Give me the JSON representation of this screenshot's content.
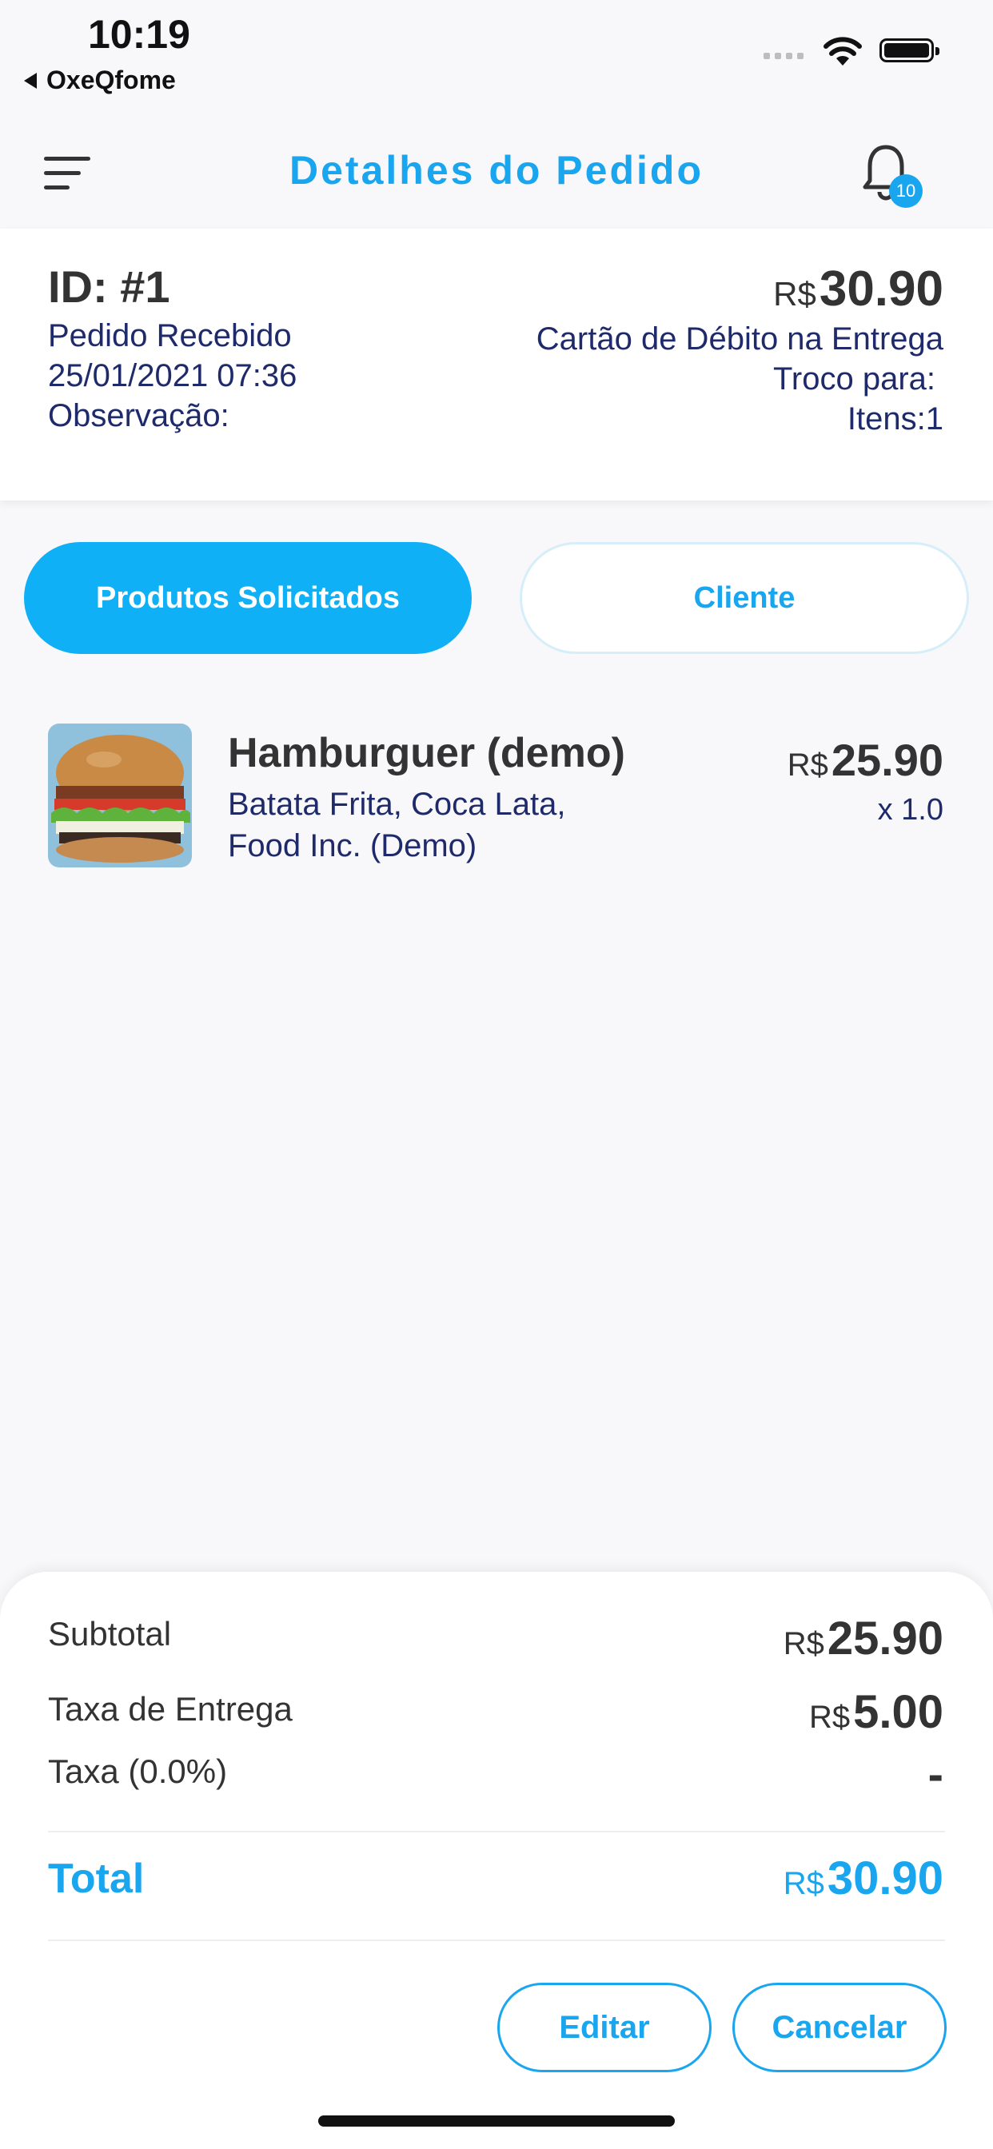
{
  "status_bar": {
    "time": "10:19",
    "back_app": "OxeQfome"
  },
  "header": {
    "title": "Detalhes do Pedido",
    "notification_count": "10"
  },
  "order": {
    "id": "ID: #1",
    "status": "Pedido Recebido",
    "datetime": "25/01/2021 07:36",
    "observation_label": "Observação:",
    "currency": "R$",
    "total_amount": "30.90",
    "payment_method": "Cartão de Débito na Entrega",
    "change_label": "Troco para:",
    "items_label": "Itens:1"
  },
  "tabs": [
    {
      "label": "Produtos Solicitados",
      "active": true
    },
    {
      "label": "Cliente",
      "active": false
    }
  ],
  "products": [
    {
      "name": "Hamburguer (demo)",
      "description_line1": "Batata Frita, Coca Lata,",
      "description_line2": "Food Inc. (Demo)",
      "currency": "R$",
      "price": "25.90",
      "quantity": "x 1.0"
    }
  ],
  "summary": {
    "currency": "R$",
    "subtotal_label": "Subtotal",
    "subtotal_value": "25.90",
    "delivery_label": "Taxa de Entrega",
    "delivery_value": "5.00",
    "tax_label": "Taxa (0.0%)",
    "tax_value": "-",
    "total_label": "Total",
    "total_value": "30.90"
  },
  "actions": {
    "edit_label": "Editar",
    "cancel_label": "Cancelar"
  },
  "colors": {
    "accent": "#1aa6ef",
    "text_dark": "#333333",
    "text_navy": "#1f2a6b",
    "background": "#f8f8fa"
  }
}
